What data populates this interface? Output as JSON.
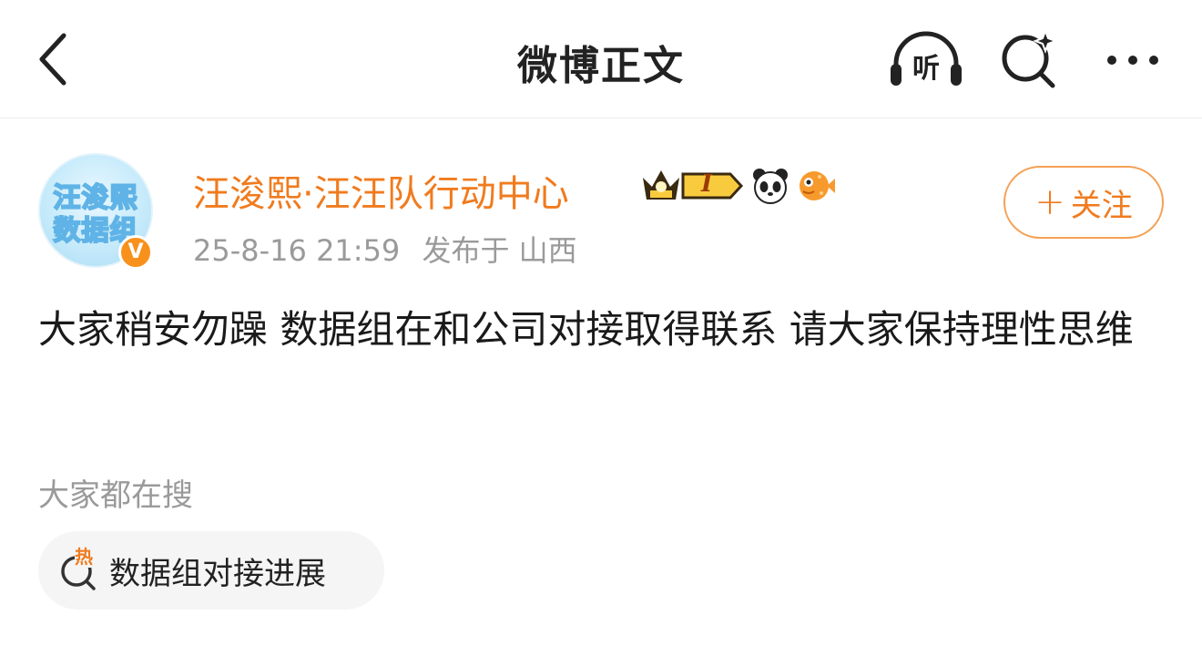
{
  "nav": {
    "title": "微博正文",
    "listen_label": "听"
  },
  "post": {
    "author": {
      "avatar_line1": "汪浚熙",
      "avatar_line2": "数据组",
      "name": "汪浚熙·汪汪队行动中心",
      "verified_mark": "V",
      "level_label": "I"
    },
    "time": "25-8-16 21:59",
    "location": "发布于 山西",
    "follow_label": "关注",
    "follow_plus": "+",
    "text": "大家稍安勿躁 数据组在和公司对接取得联系 请大家保持理性思维"
  },
  "search": {
    "label": "大家都在搜",
    "chip_text": "数据组对接进展",
    "hot_mark": "热"
  },
  "colors": {
    "accent": "#f07b1e",
    "meta_gray": "#9a9a9a",
    "chip_bg": "#f5f5f5"
  }
}
